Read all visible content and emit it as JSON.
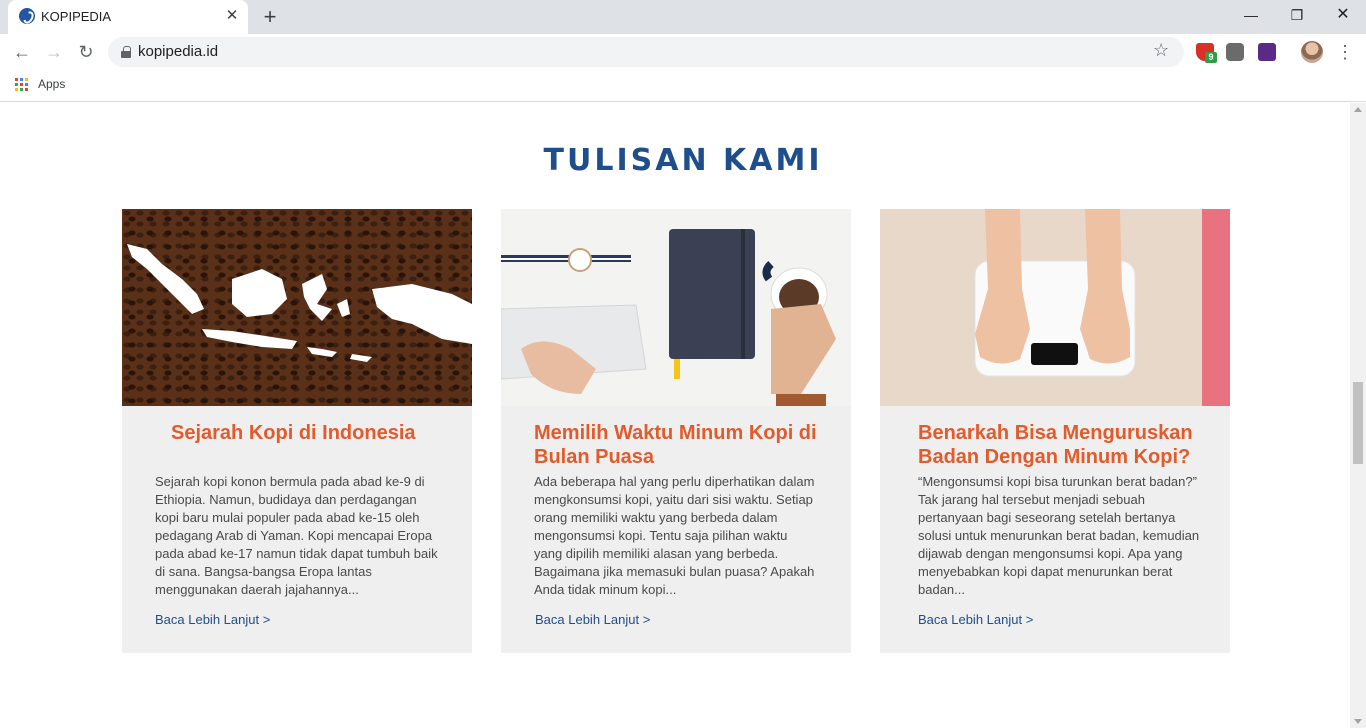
{
  "browser": {
    "tab_title": "KOPIPEDIA",
    "url": "kopipedia.id",
    "bookmark_apps": "Apps",
    "extension_badge": "9",
    "accent_color": "#1f4e8c"
  },
  "page": {
    "section_title": "TULISAN KAMI",
    "cards": [
      {
        "image": "coffee-beans-indonesia-map",
        "title": "Sejarah Kopi di Indonesia",
        "excerpt": "Sejarah kopi konon bermula pada abad ke-9 di Ethiopia. Namun, budidaya dan perdagangan kopi baru mulai populer pada abad ke-15 oleh pedagang Arab di Yaman. Kopi mencapai Eropa pada abad ke-17 namun tidak dapat tumbuh baik di sana. Bangsa-bangsa Eropa lantas menggunakan daerah jajahannya...",
        "link": "Baca Lebih Lanjut >"
      },
      {
        "image": "desk-coffee-notebook",
        "title": "Memilih Waktu Minum Kopi di Bulan Puasa",
        "excerpt": "Ada beberapa hal yang perlu diperhatikan dalam mengkonsumsi kopi, yaitu dari sisi waktu. Setiap orang memiliki waktu yang berbeda dalam mengonsumsi kopi. Tentu saja pilihan waktu yang dipilih memiliki alasan yang berbeda. Bagaimana jika memasuki bulan puasa?  Apakah Anda tidak minum kopi...",
        "link": "Baca Lebih Lanjut >"
      },
      {
        "image": "feet-on-scale",
        "title": "Benarkah Bisa Menguruskan Badan Dengan Minum Kopi?",
        "excerpt": "“Mengonsumsi kopi bisa turunkan berat badan?” Tak jarang hal tersebut menjadi sebuah pertanyaan bagi seseorang setelah bertanya solusi untuk menurunkan berat badan, kemudian dijawab dengan mengonsumsi kopi. Apa yang menyebabkan kopi dapat menurunkan berat badan...",
        "link": "Baca Lebih Lanjut >"
      }
    ],
    "title_color": "#e35a2b"
  }
}
